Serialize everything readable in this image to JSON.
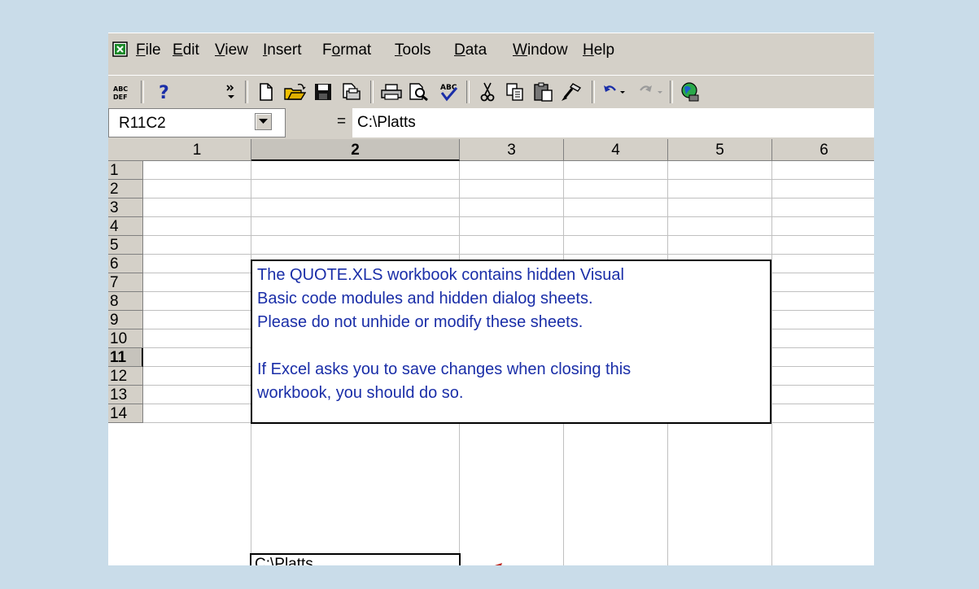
{
  "menu": {
    "items": [
      {
        "label": "File",
        "accel": "F"
      },
      {
        "label": "Edit",
        "accel": "E"
      },
      {
        "label": "View",
        "accel": "V"
      },
      {
        "label": "Insert",
        "accel": "I"
      },
      {
        "label": "Format",
        "accel": "o"
      },
      {
        "label": "Tools",
        "accel": "T"
      },
      {
        "label": "Data",
        "accel": "D"
      },
      {
        "label": "Window",
        "accel": "W"
      },
      {
        "label": "Help",
        "accel": "H"
      }
    ]
  },
  "toolbar": {
    "spelling_label": "ABC DEF",
    "help_label": "?",
    "more_label": "»"
  },
  "formula_bar": {
    "name_box": "R11C2",
    "equals": "=",
    "content": "C:\\Platts"
  },
  "grid": {
    "columns": [
      "1",
      "2",
      "3",
      "4",
      "5",
      "6"
    ],
    "rows": [
      "1",
      "2",
      "3",
      "4",
      "5",
      "6",
      "7",
      "8",
      "9",
      "10",
      "11",
      "12",
      "13",
      "14"
    ],
    "active_row": "11",
    "active_column": "2"
  },
  "note": {
    "lines": [
      "The QUOTE.XLS workbook contains hidden Visual",
      "Basic code modules and hidden dialog sheets.",
      "Please do not unhide or modify these sheets.",
      "",
      "If Excel asks you to save changes when closing this",
      "workbook, you should do so."
    ],
    "text_color": "#1a2ea8"
  },
  "active_cell": {
    "value": "C:\\Platts"
  },
  "colors": {
    "background": "#c9dce9",
    "chrome": "#d4d0c8",
    "arrow": "#c0281e"
  }
}
